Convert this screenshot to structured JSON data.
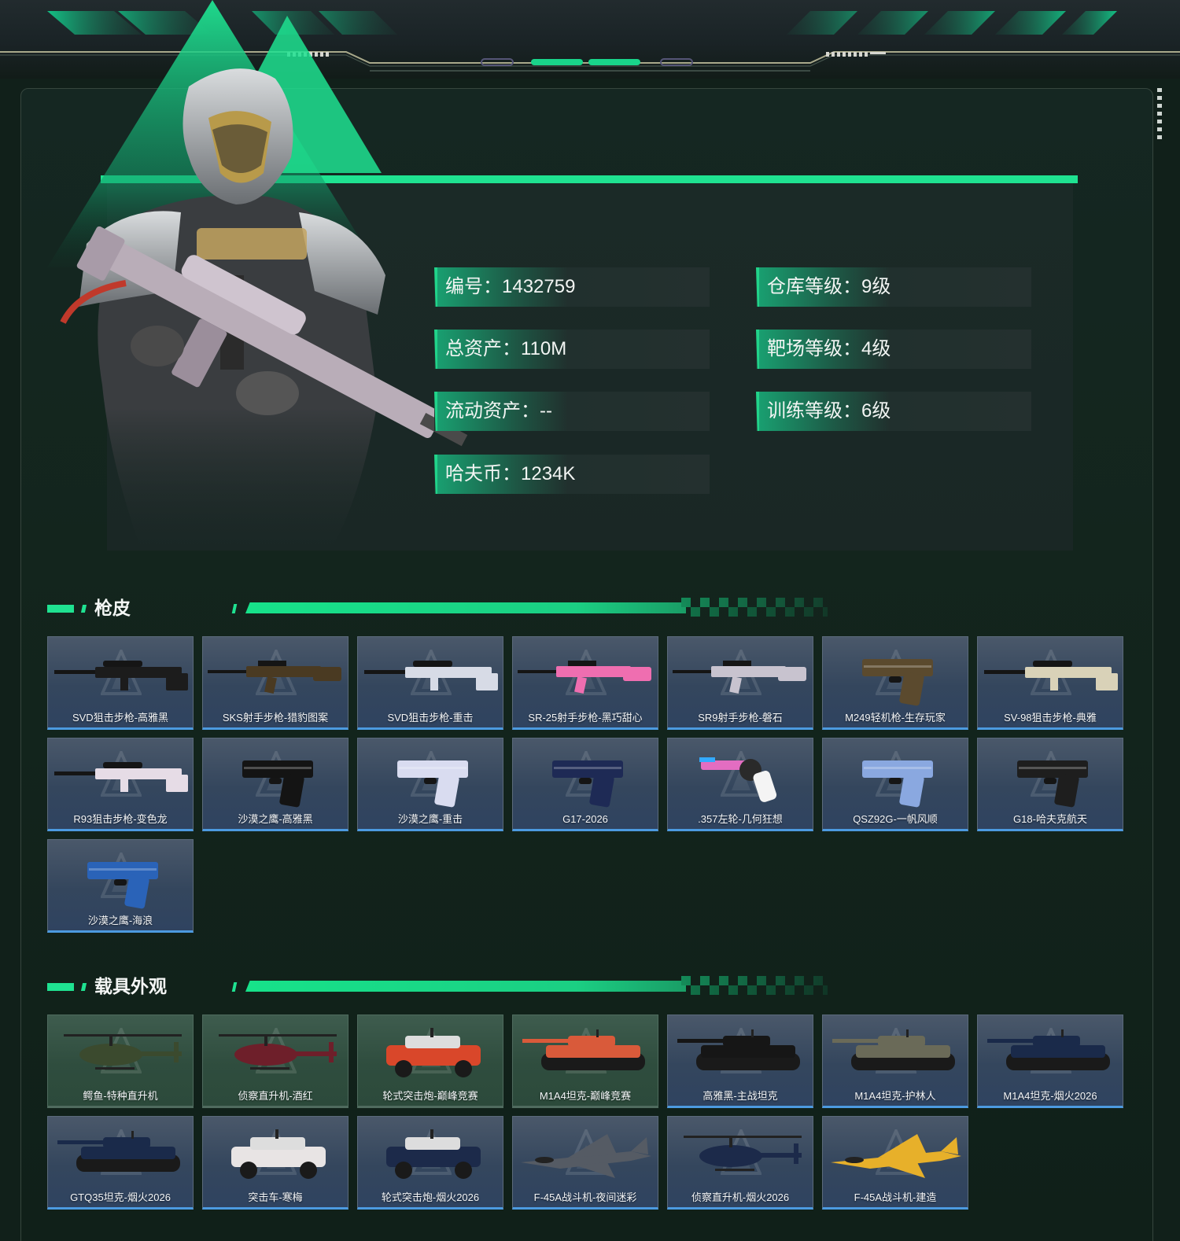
{
  "profile": {
    "stats": [
      {
        "id": "id-number",
        "text": "编号：1432759"
      },
      {
        "id": "total-assets",
        "text": "总资产：110M"
      },
      {
        "id": "liquid-assets",
        "text": "流动资产：--"
      },
      {
        "id": "havoc-coins",
        "text": "哈夫币：1234K"
      },
      {
        "id": "warehouse-level",
        "text": "仓库等级：9级"
      },
      {
        "id": "range-level",
        "text": "靶场等级：4级"
      },
      {
        "id": "training-level",
        "text": "训练等级：6级"
      }
    ]
  },
  "sections": {
    "weapon_skins": {
      "title": "枪皮",
      "items": [
        {
          "label": "SVD狙击步枪-高雅黑",
          "icon": "sniper-rifle-icon",
          "color": "#1c1c1c"
        },
        {
          "label": "SKS射手步枪-猎豹图案",
          "icon": "marksman-rifle-icon",
          "color": "#4a3a22"
        },
        {
          "label": "SVD狙击步枪-重击",
          "icon": "sniper-rifle-icon",
          "color": "#d7dbe6"
        },
        {
          "label": "SR-25射手步枪-黑巧甜心",
          "icon": "marksman-rifle-icon",
          "color": "#ef6eb0"
        },
        {
          "label": "SR9射手步枪-磐石",
          "icon": "marksman-rifle-icon",
          "color": "#c8c3cf"
        },
        {
          "label": "M249轻机枪-生存玩家",
          "icon": "pistol-icon",
          "color": "#5b4a2e"
        },
        {
          "label": "SV-98狙击步枪-典雅",
          "icon": "sniper-rifle-icon",
          "color": "#d9d2b8"
        },
        {
          "label": "R93狙击步枪-变色龙",
          "icon": "sniper-rifle-icon",
          "color": "#e6dce6"
        },
        {
          "label": "沙漠之鹰-高雅黑",
          "icon": "pistol-icon",
          "color": "#141414"
        },
        {
          "label": "沙漠之鹰-重击",
          "icon": "pistol-icon",
          "color": "#d9dcf0"
        },
        {
          "label": "G17-2026",
          "icon": "pistol-icon",
          "color": "#1e2a55"
        },
        {
          "label": ".357左轮-几何狂想",
          "icon": "revolver-icon",
          "color": "#e36dc1"
        },
        {
          "label": "QSZ92G-一帆风顺",
          "icon": "pistol-icon",
          "color": "#8aa8e0"
        },
        {
          "label": "G18-哈夫克航天",
          "icon": "pistol-icon",
          "color": "#1e1e1e"
        },
        {
          "label": "沙漠之鹰-海浪",
          "icon": "pistol-icon",
          "color": "#2a63b8"
        }
      ]
    },
    "vehicle_skins": {
      "title": "载具外观",
      "items": [
        {
          "label": "鳄鱼-特种直升机",
          "icon": "helicopter-icon",
          "color": "#3b4a2e",
          "tone": "green"
        },
        {
          "label": "侦察直升机-酒红",
          "icon": "helicopter-icon",
          "color": "#6e1f2a",
          "tone": "green"
        },
        {
          "label": "轮式突击炮-巅峰竞赛",
          "icon": "armored-car-icon",
          "color": "#d9472a",
          "tone": "green"
        },
        {
          "label": "M1A4坦克-巅峰竞赛",
          "icon": "tank-icon",
          "color": "#d95a3a",
          "tone": "green"
        },
        {
          "label": "高雅黑-主战坦克",
          "icon": "tank-icon",
          "color": "#161616",
          "tone": "blue"
        },
        {
          "label": "M1A4坦克-护林人",
          "icon": "tank-icon",
          "color": "#6a6a58",
          "tone": "blue"
        },
        {
          "label": "M1A4坦克-烟火2026",
          "icon": "tank-icon",
          "color": "#1a2a4a",
          "tone": "blue"
        },
        {
          "label": "GTQ35坦克-烟火2026",
          "icon": "tank-icon",
          "color": "#1a2a4a",
          "tone": "blue"
        },
        {
          "label": "突击车-寒梅",
          "icon": "armored-car-icon",
          "color": "#e8e4e4",
          "tone": "blue"
        },
        {
          "label": "轮式突击炮-烟火2026",
          "icon": "armored-car-icon",
          "color": "#1c2a4a",
          "tone": "blue"
        },
        {
          "label": "F-45A战斗机-夜间迷彩",
          "icon": "fighter-jet-icon",
          "color": "#555b64",
          "tone": "blue"
        },
        {
          "label": "侦察直升机-烟火2026",
          "icon": "helicopter-icon",
          "color": "#1c2a4a",
          "tone": "blue"
        },
        {
          "label": "F-45A战斗机-建造",
          "icon": "fighter-jet-icon",
          "color": "#e7b02a",
          "tone": "blue"
        }
      ]
    }
  },
  "colors": {
    "accent": "#1fe291",
    "tile_border_blue": "#4c9ae0",
    "tile_border_green": "#27d38a"
  }
}
